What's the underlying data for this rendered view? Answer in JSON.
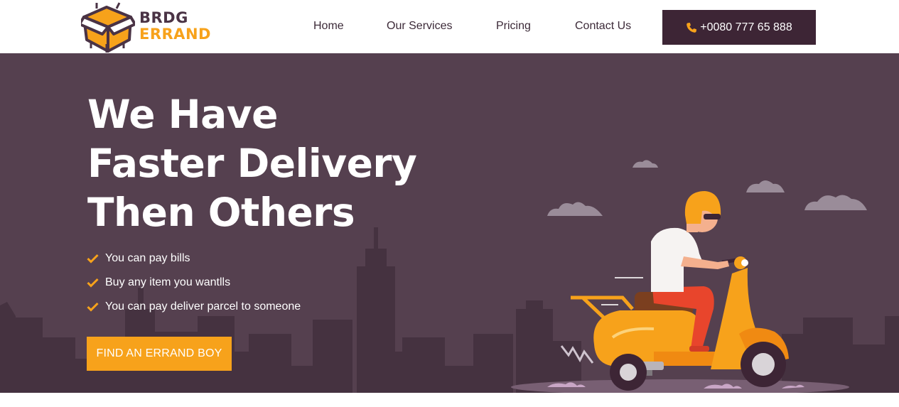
{
  "brand": {
    "line1": "BRDG",
    "line2": "ERRAND",
    "icon": "package-box-icon",
    "colors": {
      "dark": "#4a3345",
      "accent": "#f7a21b"
    }
  },
  "nav": {
    "items": [
      {
        "label": "Home"
      },
      {
        "label": "Our Services"
      },
      {
        "label": "Pricing"
      },
      {
        "label": "Contact Us"
      }
    ],
    "phone": {
      "label": "+0080 777 65 888",
      "icon": "phone-icon"
    }
  },
  "hero": {
    "title_lines": [
      "We Have",
      "Faster Delivery",
      "Then Others"
    ],
    "features": [
      "You can pay bills",
      "Buy any item you wantlls",
      "You can pay deliver parcel to someone"
    ],
    "cta_label": "FIND AN ERRAND BOY",
    "illustration": "delivery-scooter-rider-illustration",
    "colors": {
      "background": "#55404f",
      "city": "#453240",
      "accent": "#f7a21b"
    }
  }
}
